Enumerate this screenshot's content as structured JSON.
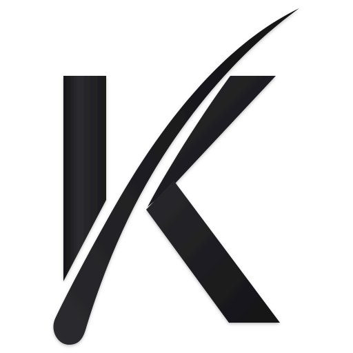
{
  "logo": {
    "letter": "K",
    "colors": {
      "background": "#ffffff",
      "fill": "#1f1f21",
      "highlight": "#34343a",
      "shadow": "#0e0e10"
    }
  }
}
